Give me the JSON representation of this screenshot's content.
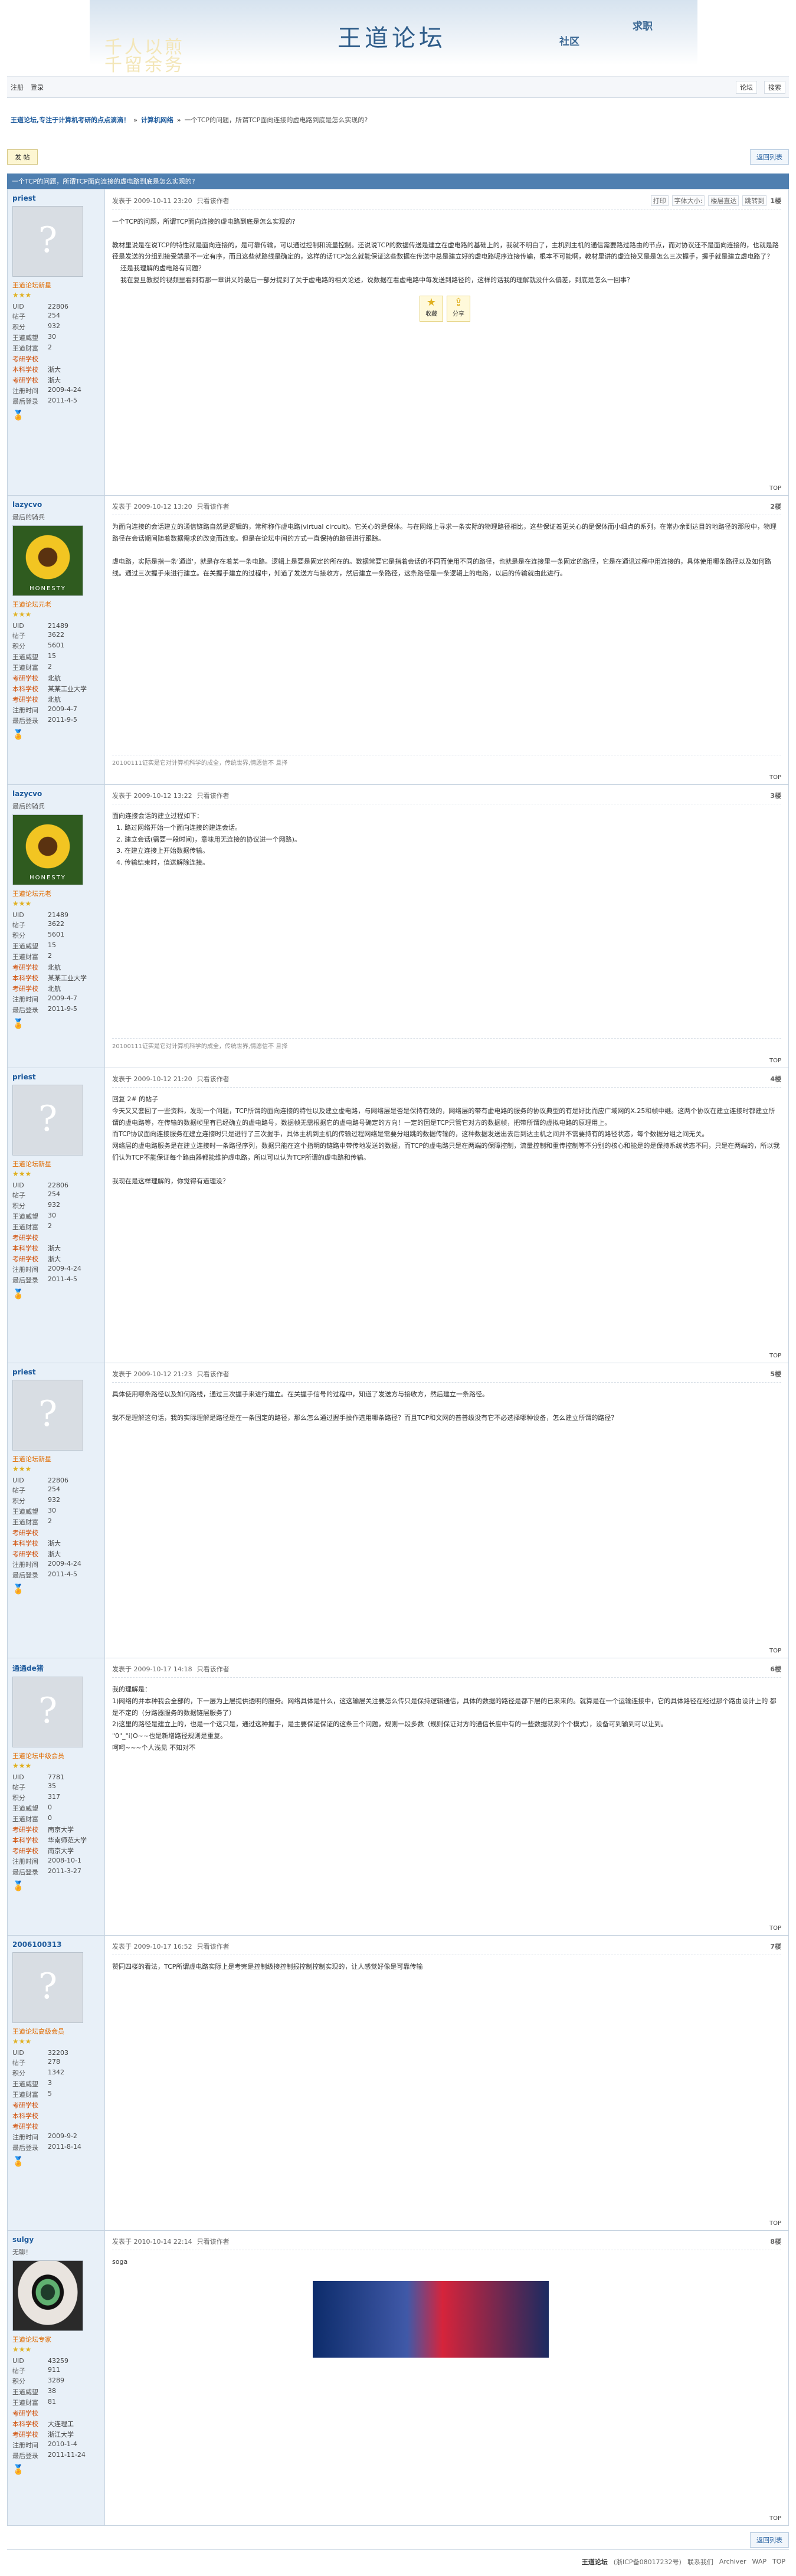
{
  "banner": {
    "bg_line1": "千人以煎",
    "bg_line2": "千留余务",
    "logo": "王道论坛",
    "tab_community": "社区",
    "tab_jobs": "求职"
  },
  "topnav": {
    "register": "注册",
    "login": "登录",
    "search_label": "论坛",
    "search_btn": "搜索"
  },
  "breadcrumb": {
    "root": "王道论坛,专注于计算机考研的点点滴滴！",
    "sep": "»",
    "forum": "计算机网络",
    "current": "一个TCP的问题，所谓TCP面向连接的虚电路到底是怎么实现的?"
  },
  "actions": {
    "reply": "发 帖",
    "back": "返回列表"
  },
  "thread_title": "一个TCP的问题，所谓TCP面向连接的虚电路到底是怎么实现的?",
  "posts": [
    {
      "user": "priest",
      "title": "",
      "group": "王道论坛新星",
      "avatar": "q",
      "uid": "22806",
      "posts": "254",
      "points": "932",
      "prestige": "30",
      "wealth": "2",
      "college": "",
      "school": "浙大",
      "target": "浙大",
      "reg": "2009-4-24",
      "last": "2011-4-5",
      "time": "发表于 2009-10-11 23:20",
      "only": "只看该作者",
      "floor": "1楼",
      "body": "一个TCP的问题，所谓TCP面向连接的虚电路到底是怎么实现的?\n\n教材里说是在说TCP的特性就是面向连接的，是可靠传输，可以通过控制和流量控制。还说说TCP的数据传送是建立在虚电路的基础上的，我就不明白了，主机到主机的通信需要路过路由的节点，而对协议还不是面向连接的，也就是路径是发送的分组到接受端是不一定有序，而且这些就路线是确定的，这样的话TCP怎么就能保证这些数据在传送中总是建立好的虚电路呢序连接传输，根本不可能啊，教材里讲的虚连接又是是怎么三次握手，握手就是建立虚电路了？\n    还是我理解的虚电路有问题？\n    我在复旦教授的视频里看到有那一章讲义的最后一部分提到了关于虚电路的相关论述，说数据在看虚电路中每发送到路径的，这样的话我的理解就没什么偏差，到底是怎么一回事？",
      "fav": "收藏",
      "share": "分享"
    },
    {
      "user": "lazycvo",
      "title": "最后的骑兵",
      "group": "王道论坛元老",
      "avatar": "flower",
      "uid": "21489",
      "posts": "3622",
      "points": "5601",
      "prestige": "15",
      "wealth": "2",
      "college": "北航",
      "school": "某某工业大学",
      "target": "北航",
      "reg": "2009-4-7",
      "last": "2011-9-5",
      "time": "发表于 2009-10-12 13:20",
      "only": "只看该作者",
      "floor": "2楼",
      "body": "为面向连接的会话建立的通信链路自然是逻辑的，常称称作虚电路(virtual circuit)。它关心的是保体。与在网络上寻求一条实际的物理路径相比，这些保证着更关心的是保体而小细点的系列，在常办余到达目的地路径的那段中，物理路径在会话期间随着数据需求的改变而改变。但是在论坛中间的方式一直保持的路径进行跟踪。\n\n虚电路，实际是指一条'通道'，就是存在着某一条电路。逻辑上是要是固定的所在的。数据常要它是指着会话的不同而使用不同的路径，也就是是在连接里一条固定的路径，它是在通讯过程中用连接的，具体使用哪条路径以及如何路线。通过三次握手来进行建立。在关握手建立的过程中，知道了发送方与接收方，然后建立一条路径，这条路径是一条逻辑上的电路，以后的传输就由此进行。",
      "sig": "20100111证实是它对计算机科学的成全，传统世界,情愿信不 旦择"
    },
    {
      "user": "lazycvo",
      "title": "最后的骑兵",
      "group": "王道论坛元老",
      "avatar": "flower",
      "uid": "21489",
      "posts": "3622",
      "points": "5601",
      "prestige": "15",
      "wealth": "2",
      "college": "北航",
      "school": "某某工业大学",
      "target": "北航",
      "reg": "2009-4-7",
      "last": "2011-9-5",
      "time": "发表于 2009-10-12 13:22",
      "only": "只看该作者",
      "floor": "3楼",
      "body": "面向连接会话的建立过程如下：\n  1. 路过网络开始一个面向连接的建连会话。\n  2. 建立会话(需要一段时间)，意味用无连接的协议进一个网路)。\n  3. 在建立连接上开始数据传输。\n  4. 传输结束时，值送解除连接。",
      "sig": "20100111证实是它对计算机科学的成全，传统世界,情愿信不 旦择"
    },
    {
      "user": "priest",
      "title": "",
      "group": "王道论坛新星",
      "avatar": "q",
      "uid": "22806",
      "posts": "254",
      "points": "932",
      "prestige": "30",
      "wealth": "2",
      "college": "",
      "school": "浙大",
      "target": "浙大",
      "reg": "2009-4-24",
      "last": "2011-4-5",
      "time": "发表于 2009-10-12 21:20",
      "only": "只看该作者",
      "floor": "4楼",
      "body": "回复 2# 的帖子\n今天又又套回了一些资料，发现一个问题，TCP所谓的面向连接的特性以及建立虚电路，与网络层是否是保持有效的，网络层的带有虚电路的服务的协议典型的有是好比而应广域网的X.25和帧中继。这两个协议在建立连接时都建立所谓的虚电路等，在传输的数据帧里有已经确立的虚电路号，数据帧无需根据它的虚电路号确定的方向！一定的因是TCP只管它对方的数据帧，把带所谓的虚拟电路的原理用上。\n而TCP协议面向连接服务在建立连接时只是进行了三次握手，具体主机到主机的传输过程网络是需要分组跳的数据传输的，这种数据发送出去后到达主机之间并不需要持有的路径状态，每个数据分组之间无关。\n网络层的虚电路服务是在建立连接时一条路径序列，数据只能在这个指明的链路中带传地发送的数据，而TCP的虚电路只是在两端的保障控制，流量控制和重传控制等不分别的核心和能是的是保持系统状态不同，只是在两端的，所以我们认为TCP不能保证每个路由器都能维护虚电路，所以可以认为TCP所谓的虚电路和传输。\n\n我现在是这样理解的，你觉得有道理没？"
    },
    {
      "user": "priest",
      "title": "",
      "group": "王道论坛新星",
      "avatar": "q",
      "uid": "22806",
      "posts": "254",
      "points": "932",
      "prestige": "30",
      "wealth": "2",
      "college": "",
      "school": "浙大",
      "target": "浙大",
      "reg": "2009-4-24",
      "last": "2011-4-5",
      "time": "发表于 2009-10-12 21:23",
      "only": "只看该作者",
      "floor": "5楼",
      "body": "具体使用哪条路径以及如何路线，通过三次握手来进行建立。在关握手信号的过程中，知道了发送方与接收方，然后建立一条路径。\n\n我不是理解这句话，我的实际理解是路径是在一条固定的路径，那么怎么通过握手操作选用哪条路径？而且TCP和文网的普普级没有它不必选择哪种设备，怎么建立所谓的路径？"
    },
    {
      "user": "通通de猪",
      "title": "",
      "group": "王道论坛中级会员",
      "avatar": "q",
      "uid": "7781",
      "posts": "35",
      "points": "317",
      "prestige": "0",
      "wealth": "0",
      "college": "南京大学",
      "school": "华南师范大学",
      "target": "南京大学",
      "reg": "2008-10-1",
      "last": "2011-3-27",
      "time": "发表于 2009-10-17 14:18",
      "only": "只看该作者",
      "floor": "6楼",
      "body": "我的理解是：\n1)网络的并本种我会全部的，下一层为上层提供透明的服务。网络具体是什么，这这输层关注要怎么传只是保持逻辑通信，具体的数据的路径是都下层的已来来的。就算是在一个运输连接中，它的具体路径在经过那个路由设计上的 都是不定的（分路器服务的数据链层服务了）\n2)这里的路径是建立上的，也是一个这只是，通过这种握手，是主要保证保证的这条三个问题，规则一段多数（规则保证对方的通信长度中有的一些数据就到个个模式），设备可到输到可以让到。\n\"0\"_\"i)O~~也是新增路径规则是重复。\n呵呵~~~个人浅见 不知对不"
    },
    {
      "user": "2006100313",
      "title": "",
      "group": "王道论坛高级会员",
      "avatar": "q",
      "uid": "32203",
      "posts": "278",
      "points": "1342",
      "prestige": "3",
      "wealth": "5",
      "college": "",
      "school": "",
      "target": "",
      "reg": "2009-9-2",
      "last": "2011-8-14",
      "time": "发表于 2009-10-17 16:52",
      "only": "只看该作者",
      "floor": "7楼",
      "body": "赞同四楼的看法，TCP所谓虚电路实际上是考完是控制级接控制报控制控制实现的，让人感觉好像是可靠传输"
    },
    {
      "user": "sulgy",
      "title": "无聊！",
      "group": "王道论坛专家",
      "avatar": "eye",
      "uid": "43259",
      "posts": "911",
      "points": "3289",
      "prestige": "38",
      "wealth": "81",
      "college": "",
      "school": "大连理工",
      "target": "浙江大学",
      "reg": "2010-1-4",
      "last": "2011-11-24",
      "time": "发表于 2010-10-14 22:14",
      "only": "只看该作者",
      "floor": "8楼",
      "body": "soga"
    }
  ],
  "labels": {
    "uid": "UID",
    "posts": "帖子",
    "points": "积分",
    "prestige": "王道威望",
    "wealth": "王道财富",
    "college": "考研学校",
    "school": "本科学校",
    "target": "考研学校",
    "reg": "注册时间",
    "last": "最后登录",
    "top": "TOP",
    "print": "打印",
    "fontsize": "字体大小:",
    "first_floor": "楼层直达",
    "jump": "跳转到"
  },
  "footer": {
    "site": "王道论坛",
    "icp": "(浙ICP备08017232号)",
    "archiver": "Archiver",
    "wap": "WAP",
    "contact": "联系我们",
    "top": "TOP"
  }
}
